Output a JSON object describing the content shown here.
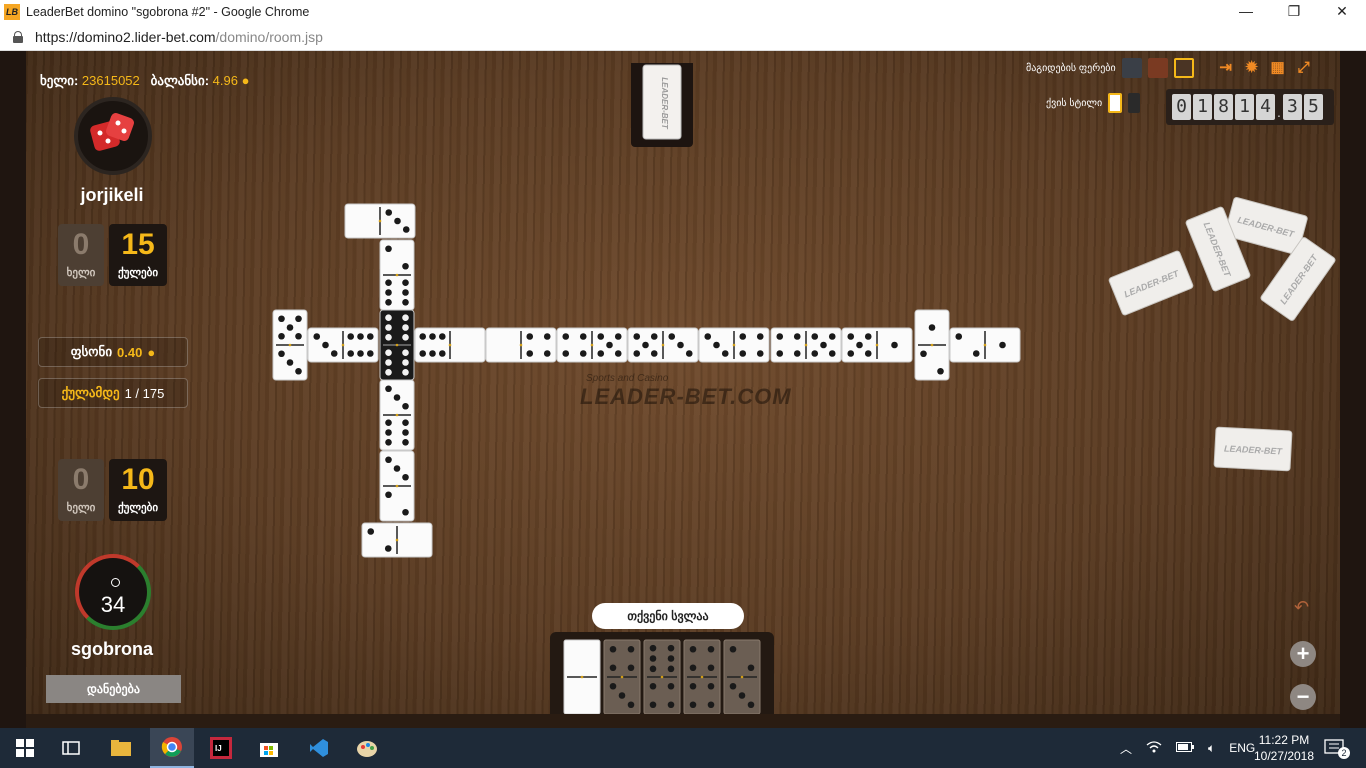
{
  "window": {
    "title": "LeaderBet domino \"sgobrona #2\" - Google Chrome",
    "logo_text": "LB",
    "minimize": "—",
    "maximize": "❐",
    "close": "✕"
  },
  "address_bar": {
    "url_host": "https://domino2.lider-bet.com",
    "url_path": "/domino/room.jsp"
  },
  "header": {
    "hand_label": "ხელი",
    "hand_value": "23615052",
    "balance_label": "ბალანსი",
    "balance_value": "4.96"
  },
  "opponent": {
    "name": "jorjikeli",
    "hands": "0",
    "hands_label": "ხელი",
    "points": "15",
    "points_label": "ქულები"
  },
  "info": {
    "stake_label": "ფსონი",
    "stake_value": "0.40",
    "target_label": "ქულამდე",
    "target_value": "1 / 175"
  },
  "player": {
    "name": "sgobrona",
    "hands": "0",
    "hands_label": "ხელი",
    "points": "10",
    "points_label": "ქულები",
    "timer": "34",
    "surrender_label": "დანებება"
  },
  "settings": {
    "table_color_label": "მაგიდების ფერები",
    "tile_color_label": "ქვის სტილი",
    "swatch_colors": [
      "#3a3f47",
      "#7a3a22",
      "#4a3424"
    ],
    "counter_digits": [
      "0",
      "1",
      "8",
      "1",
      "4"
    ],
    "counter_decimals": [
      "3",
      "5"
    ],
    "icons": [
      "exit-icon",
      "gear-icon",
      "grid-icon",
      "fullscreen-icon"
    ]
  },
  "board": {
    "watermark": "LEADER-BET.COM",
    "watermark_sub": "Sports and Casino",
    "boneyard_brand": "LEADER-BET",
    "boneyard_brand_sub": "Sports and Casino"
  },
  "turn_label": "თქვენი სვლაა",
  "controls": {
    "undo": "↶",
    "zoom_in": "+",
    "zoom_out": "−"
  },
  "taskbar": {
    "lang": "ENG",
    "time": "11:22 PM",
    "date": "10/27/2018",
    "notif_count": "2"
  }
}
